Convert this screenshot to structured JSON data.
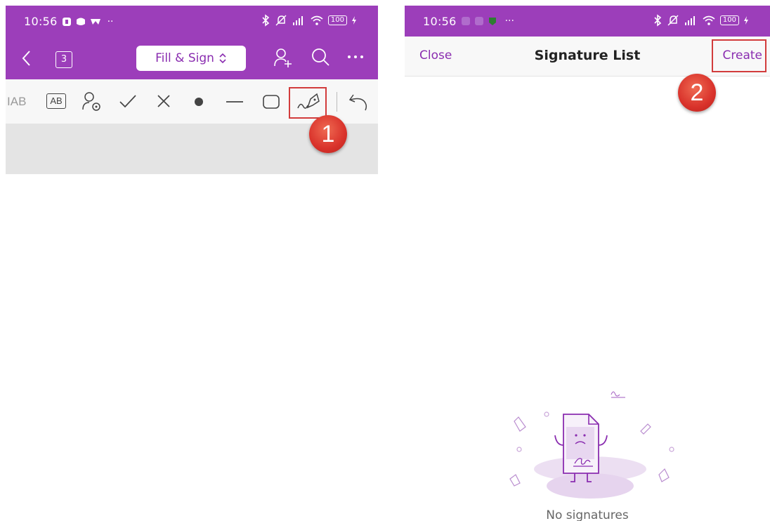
{
  "left_screen": {
    "status_bar": {
      "time": "10:56",
      "battery": "100"
    },
    "app_bar": {
      "page_count": "3",
      "mode_label": "Fill & Sign"
    },
    "toolbar": {
      "text_tool_label": "AB",
      "boxed_text_tool_label": "AB"
    },
    "step_marker": "1"
  },
  "right_screen": {
    "status_bar": {
      "time": "10:56",
      "battery": "100"
    },
    "nav": {
      "close_label": "Close",
      "title": "Signature List",
      "create_label": "Create"
    },
    "step_marker": "2",
    "empty_state": {
      "text": "No signatures"
    }
  },
  "colors": {
    "brand_purple": "#9c3eba",
    "link_purple": "#8a2db0",
    "highlight_red": "#d23c3c",
    "marker_red": "#d9322b"
  },
  "icons": [
    "back-chevron-icon",
    "add-person-icon",
    "search-icon",
    "more-dots-icon",
    "person-settings-icon",
    "checkmark-icon",
    "cross-icon",
    "dot-icon",
    "line-icon",
    "rectangle-icon",
    "signature-pen-icon",
    "undo-icon",
    "bluetooth-icon",
    "mute-icon",
    "signal-icon",
    "wifi-icon",
    "battery-icon"
  ]
}
